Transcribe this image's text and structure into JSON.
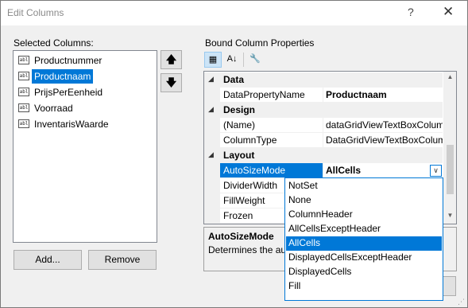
{
  "window": {
    "title": "Edit Columns",
    "help_glyph": "?",
    "close_glyph": "✕"
  },
  "selected_columns": {
    "label": "Selected Columns:",
    "icon_text": "abl",
    "items": [
      {
        "label": "Productnummer"
      },
      {
        "label": "Productnaam",
        "selected": true
      },
      {
        "label": "PrijsPerEenheid"
      },
      {
        "label": "Voorraad"
      },
      {
        "label": "InventarisWaarde"
      }
    ],
    "move_up_glyph": "🡅",
    "move_down_glyph": "🡇",
    "add_label": "Add...",
    "remove_label": "Remove"
  },
  "properties": {
    "label": "Bound Column Properties",
    "toolbar": {
      "categorized_glyph": "▦",
      "alphabetical_glyph": "A↓",
      "property_pages_glyph": "🔧"
    },
    "categories": [
      {
        "name": "Data",
        "rows": [
          {
            "name": "DataPropertyName",
            "value": "Productnaam",
            "bold": true
          }
        ]
      },
      {
        "name": "Design",
        "rows": [
          {
            "name": "(Name)",
            "value": "dataGridViewTextBoxColum"
          },
          {
            "name": "ColumnType",
            "value": "DataGridViewTextBoxColum"
          }
        ]
      },
      {
        "name": "Layout",
        "rows": [
          {
            "name": "AutoSizeMode",
            "value": "AllCells",
            "bold": true,
            "selected": true
          },
          {
            "name": "DividerWidth",
            "value": ""
          },
          {
            "name": "FillWeight",
            "value": ""
          },
          {
            "name": "Frozen",
            "value": ""
          }
        ]
      }
    ],
    "collapse_glyph": "◢",
    "dropdown_glyph": "∨",
    "scroll_up_glyph": "▲",
    "scroll_down_glyph": "▼"
  },
  "description": {
    "title": "AutoSizeMode",
    "text": "Determines the au"
  },
  "autosize_dropdown": {
    "options": [
      "NotSet",
      "None",
      "ColumnHeader",
      "AllCellsExceptHeader",
      "AllCells",
      "DisplayedCellsExceptHeader",
      "DisplayedCells",
      "Fill"
    ],
    "selected": "AllCells"
  },
  "resize_grip_glyph": "⋰"
}
